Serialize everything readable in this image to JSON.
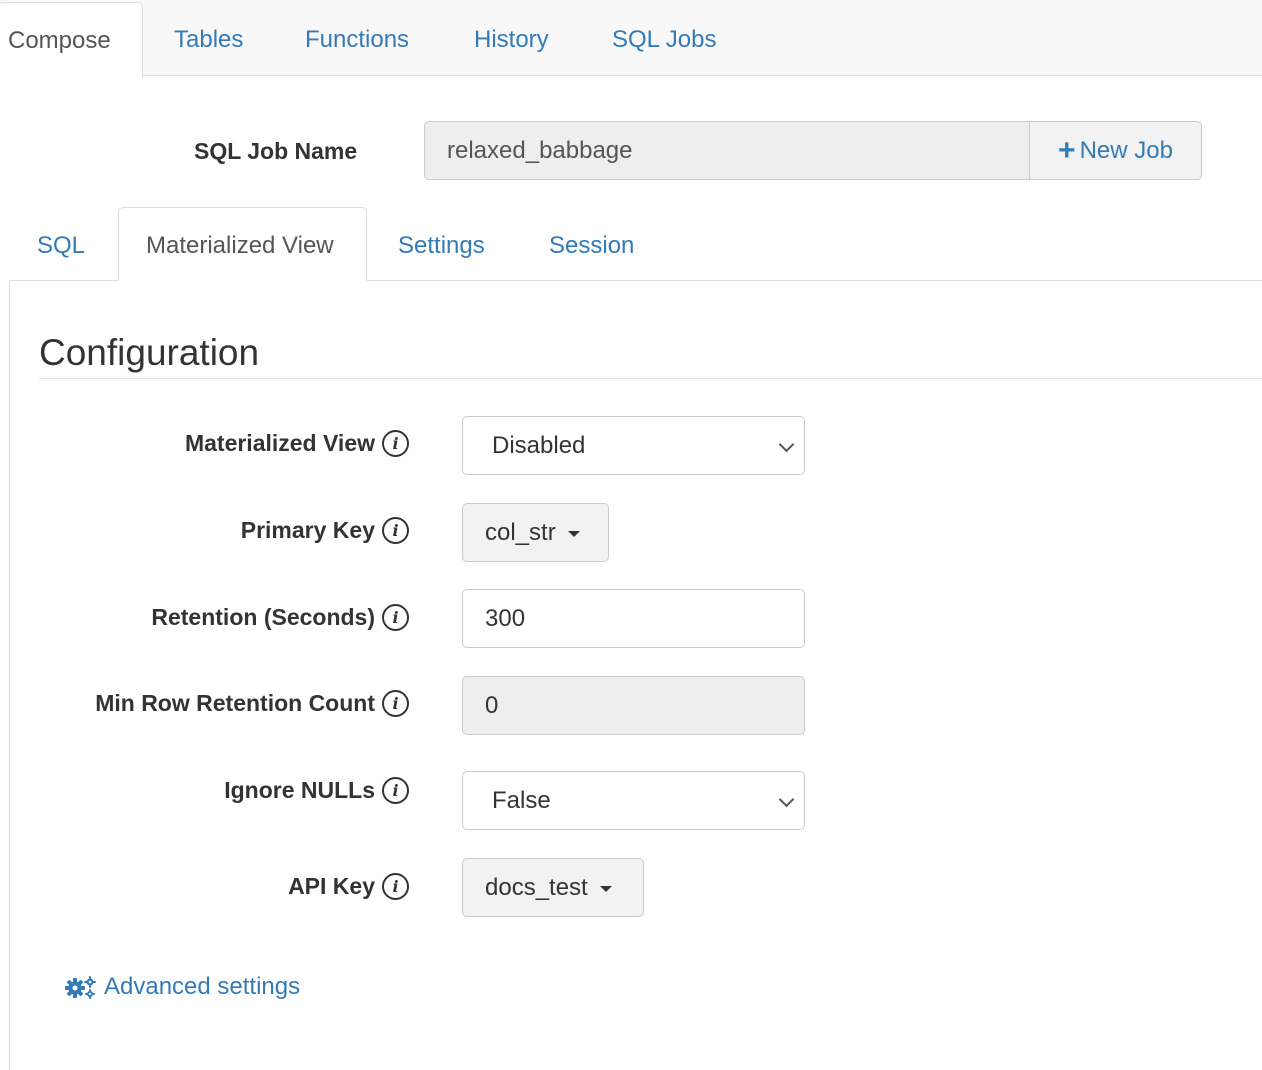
{
  "top_tabs": [
    "Compose",
    "Tables",
    "Functions",
    "History",
    "SQL Jobs"
  ],
  "job": {
    "label": "SQL Job Name",
    "value": "relaxed_babbage",
    "new_job_label": "New Job"
  },
  "sub_tabs": [
    "SQL",
    "Materialized View",
    "Settings",
    "Session"
  ],
  "section_title": "Configuration",
  "fields": {
    "materialized_view": {
      "label": "Materialized View",
      "value": "Disabled"
    },
    "primary_key": {
      "label": "Primary Key",
      "value": "col_str"
    },
    "retention": {
      "label": "Retention (Seconds)",
      "value": "300"
    },
    "min_row_retention": {
      "label": "Min Row Retention Count",
      "value": "0"
    },
    "ignore_nulls": {
      "label": "Ignore NULLs",
      "value": "False"
    },
    "api_key": {
      "label": "API Key",
      "value": "docs_test"
    }
  },
  "info_glyph": "i",
  "advanced_settings_label": "Advanced settings",
  "icons": [
    "plus-icon",
    "info-icon",
    "chevron-down-icon",
    "caret-down-icon",
    "gears-icon"
  ],
  "colors": {
    "link": "#337ab7",
    "text": "#333333",
    "border": "#dddddd",
    "disabled_bg": "#eeeeee"
  }
}
